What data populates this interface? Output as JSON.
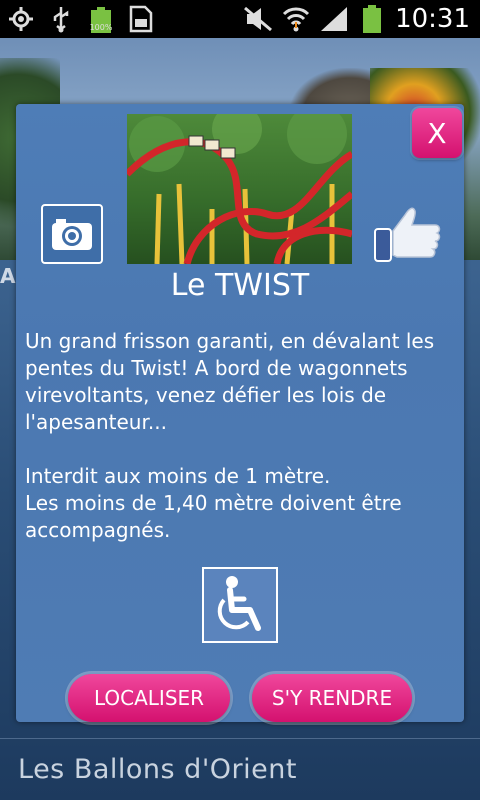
{
  "status_bar": {
    "time": "10:31",
    "battery_small_label": "100%",
    "icons": [
      "gps-icon",
      "usb-icon",
      "battery-full-icon",
      "sd-card-icon",
      "mute-icon",
      "wifi-icon",
      "signal-icon",
      "battery-icon"
    ]
  },
  "background": {
    "partial_letter": "A",
    "section_title": "Les Ballons d'Orient"
  },
  "modal": {
    "close_label": "X",
    "title": "Le TWIST",
    "description": [
      "Un grand frisson garanti, en dévalant les pentes du Twist! A bord de wagonnets virevoltants, venez défier les lois de l'apesanteur...",
      "",
      "Interdit aux moins de 1 mètre.",
      "Les moins de 1,40 mètre doivent être accompagnés."
    ],
    "camera_icon": "camera-icon",
    "like_icon": "thumbs-up-icon",
    "accessibility_icon": "wheelchair-icon",
    "buttons": {
      "localiser": "LOCALISER",
      "rendre": "S'Y RENDRE"
    }
  },
  "colors": {
    "accent_pink": "#e3187f",
    "modal_blue": "#4b79b3",
    "status_bar": "#000000"
  }
}
